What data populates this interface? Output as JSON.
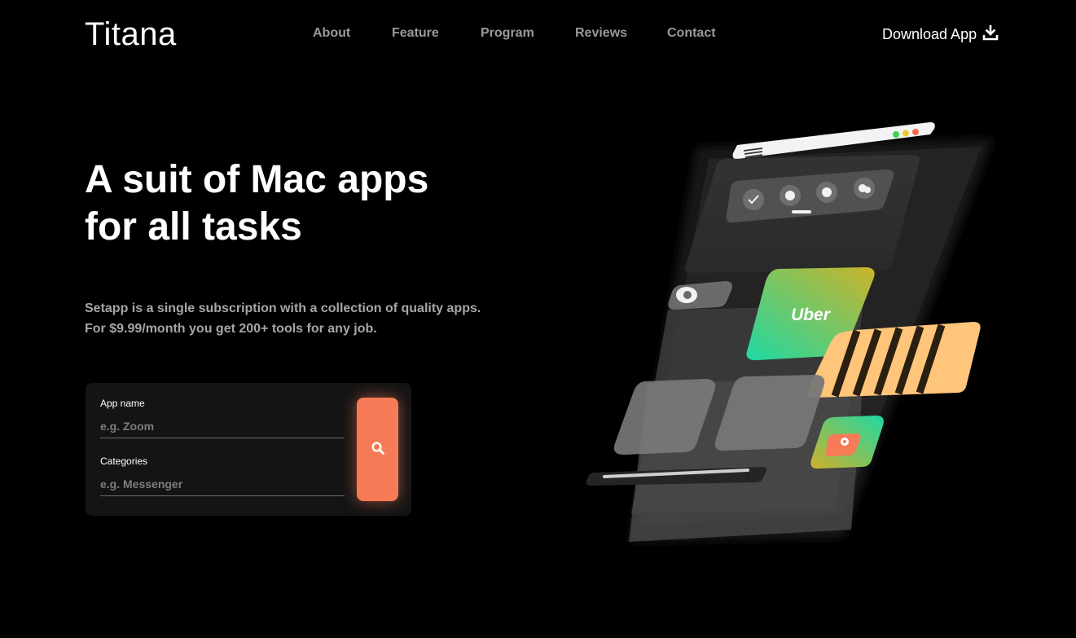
{
  "header": {
    "logo": "Titana",
    "nav": [
      {
        "label": "About"
      },
      {
        "label": "Feature"
      },
      {
        "label": "Program"
      },
      {
        "label": "Reviews"
      },
      {
        "label": "Contact"
      }
    ],
    "download_label": "Download App"
  },
  "hero": {
    "headline_line1": "A suit of Mac apps",
    "headline_line2": "for all tasks",
    "subtitle_line1": "Setapp is a single subscription with a collection of quality apps.",
    "subtitle_line2": "For $9.99/month you get 200+ tools for any job."
  },
  "search": {
    "app_label": "App name",
    "app_placeholder": "e.g. Zoom",
    "category_label": "Categories",
    "category_placeholder": "e.g. Messenger",
    "button_icon": "search-icon"
  },
  "illustration": {
    "uber_label": "Uber"
  },
  "colors": {
    "background": "#000000",
    "accent": "#f77b56",
    "nav_text": "#9a9a9a",
    "subtitle_text": "#a6a6a6",
    "card": "#141414",
    "stripe_yellow": "#ffc57a"
  }
}
